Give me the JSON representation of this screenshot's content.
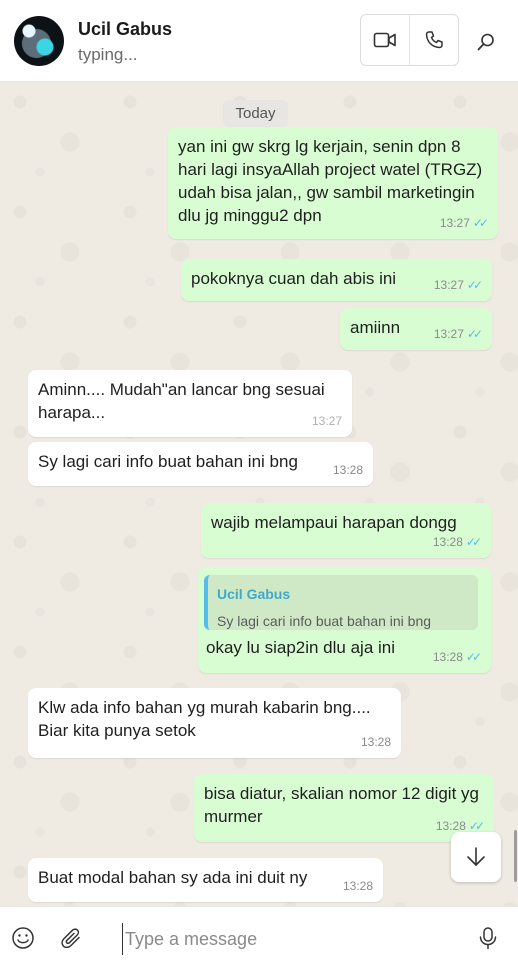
{
  "header": {
    "contact_name": "Ucil Gabus",
    "status": "typing...",
    "icons": [
      "video-call-icon",
      "voice-call-icon",
      "search-icon"
    ]
  },
  "chat": {
    "day_label": "Today",
    "messages": [
      {
        "dir": "out",
        "text": "yan ini gw skrg lg kerjain, senin dpn 8 hari lagi insyaAllah project watel (TRGZ) udah bisa jalan,, gw sambil marketingin dlu jg minggu2 dpn",
        "time": "13:27",
        "ticks": "✓✓"
      },
      {
        "dir": "out",
        "text": "pokoknya cuan dah abis ini",
        "time": "13:27",
        "ticks": "✓✓"
      },
      {
        "dir": "out",
        "text": "amiinn",
        "time": "13:27",
        "ticks": "✓✓"
      },
      {
        "dir": "in",
        "text": "Aminn.... Mudah\"an lancar bng sesuai harapa...",
        "time": "13:27"
      },
      {
        "dir": "in",
        "text": "Sy lagi cari info buat bahan ini bng",
        "time": "13:28"
      },
      {
        "dir": "out",
        "text": "wajib melampaui harapan dongg",
        "time": "13:28",
        "ticks": "✓✓"
      },
      {
        "dir": "out",
        "text": "okay lu siap2in dlu aja ini",
        "time": "13:28",
        "ticks": "✓✓",
        "quote": {
          "author": "Ucil Gabus",
          "text": "Sy lagi cari info buat bahan ini bng"
        }
      },
      {
        "dir": "in",
        "text": "Klw ada info bahan yg murah kabarin bng.... Biar kita punya setok",
        "time": "13:28"
      },
      {
        "dir": "out",
        "text": "bisa diatur, skalian nomor 12 digit yg murmer",
        "time": "13:28",
        "ticks": "✓✓"
      },
      {
        "dir": "in",
        "text": "Buat modal bahan sy ada ini duit ny",
        "time": "13:28"
      }
    ]
  },
  "composer": {
    "placeholder": "Type a message",
    "icons": [
      "emoji-icon",
      "attach-icon",
      "microphone-icon"
    ]
  },
  "colors": {
    "outgoing_bubble": "#d9fdd3",
    "incoming_bubble": "#ffffff",
    "read_ticks": "#53bdeb",
    "chat_background": "#efeae2"
  }
}
